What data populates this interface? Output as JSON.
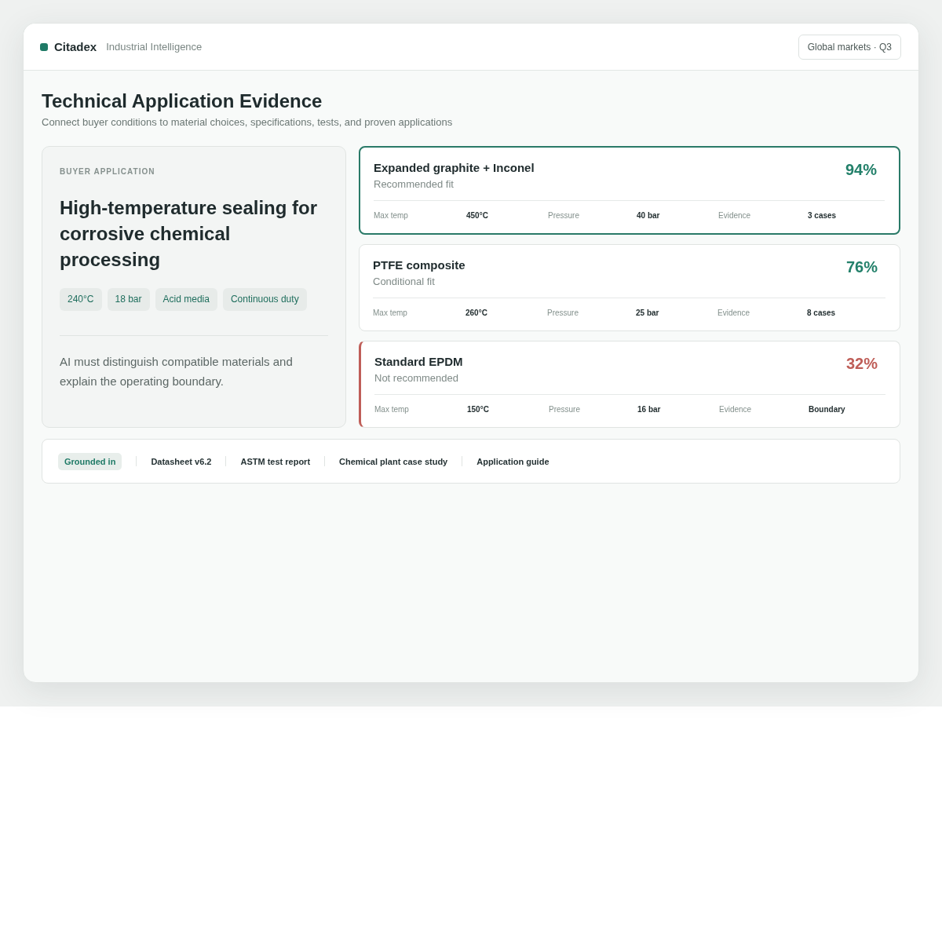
{
  "header": {
    "logo": "Citadex",
    "tagline": "Industrial Intelligence",
    "scope": "Global markets · Q3"
  },
  "page": {
    "title": "Technical Application Evidence",
    "subtitle": "Connect buyer conditions to material choices, specifications, tests, and proven applications"
  },
  "application": {
    "eyebrow": "BUYER APPLICATION",
    "title": "High-temperature sealing for corrosive chemical processing",
    "tags": [
      "240°C",
      "18 bar",
      "Acid media",
      "Continuous duty"
    ],
    "note": "AI must distinguish compatible materials and explain the operating boundary."
  },
  "materials": [
    {
      "name": "Expanded graphite + Inconel",
      "status": "Recommended fit",
      "score": "94%",
      "kind": "recommended",
      "selected": true,
      "stats": [
        {
          "label": "Max temp",
          "value": "450°C"
        },
        {
          "label": "Pressure",
          "value": "40 bar"
        },
        {
          "label": "Evidence",
          "value": "3 cases"
        }
      ]
    },
    {
      "name": "PTFE composite",
      "status": "Conditional fit",
      "score": "76%",
      "kind": "conditional",
      "selected": false,
      "stats": [
        {
          "label": "Max temp",
          "value": "260°C"
        },
        {
          "label": "Pressure",
          "value": "25 bar"
        },
        {
          "label": "Evidence",
          "value": "8 cases"
        }
      ]
    },
    {
      "name": "Standard EPDM",
      "status": "Not recommended",
      "score": "32%",
      "kind": "rejected",
      "selected": false,
      "stats": [
        {
          "label": "Max temp",
          "value": "150°C"
        },
        {
          "label": "Pressure",
          "value": "16 bar"
        },
        {
          "label": "Evidence",
          "value": "Boundary"
        }
      ]
    }
  ],
  "sources": {
    "label": "Grounded in",
    "items": [
      "Datasheet v6.2",
      "ASTM test report",
      "Chemical plant case study",
      "Application guide"
    ]
  }
}
